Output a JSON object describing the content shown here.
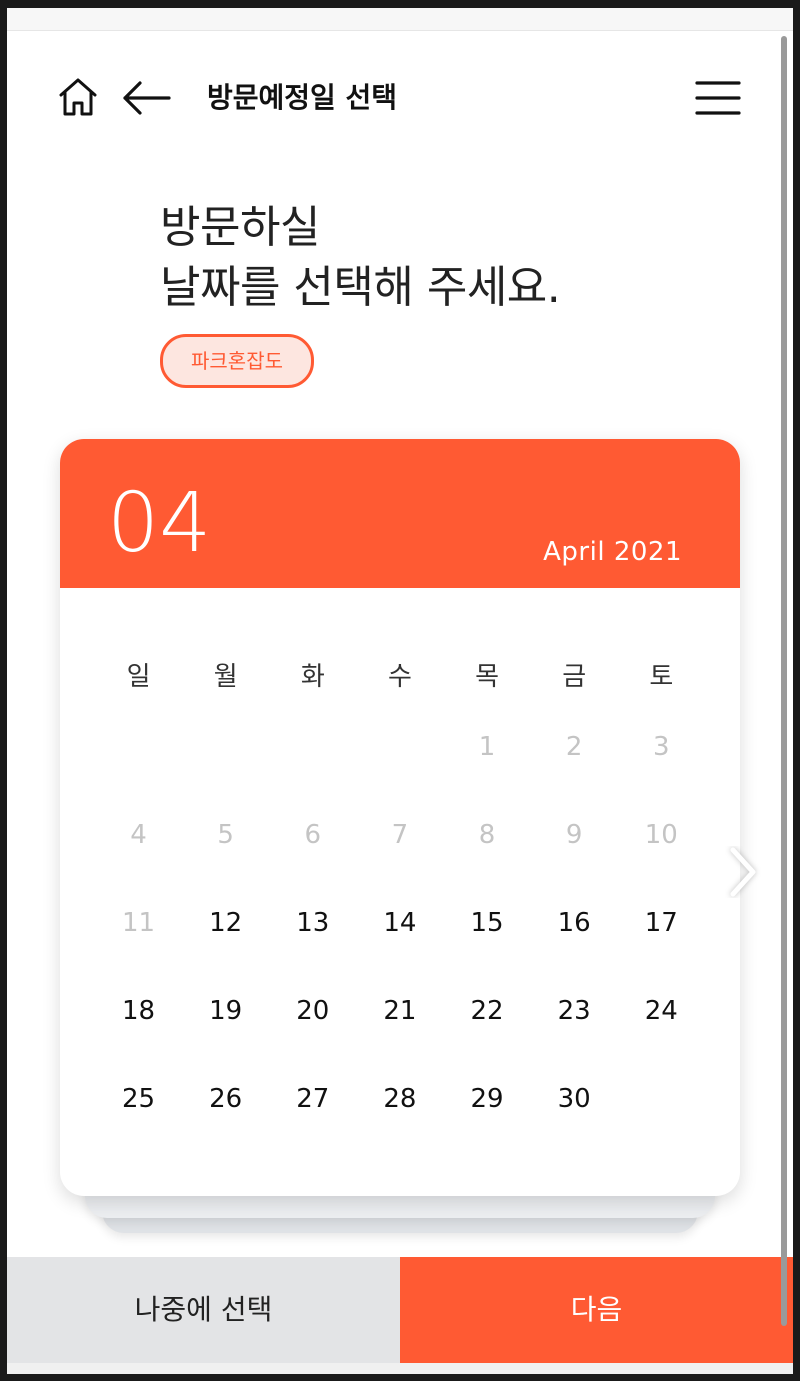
{
  "header": {
    "title": "방문예정일 선택"
  },
  "headline": {
    "line1": "방문하실",
    "line2": "날짜를 선택해 주세요."
  },
  "badge": {
    "label": "파크혼잡도"
  },
  "calendar": {
    "month": "04",
    "month_year": "April 2021",
    "weekdays": [
      "일",
      "월",
      "화",
      "수",
      "목",
      "금",
      "토"
    ],
    "weeks": [
      [
        {
          "d": ""
        },
        {
          "d": ""
        },
        {
          "d": ""
        },
        {
          "d": ""
        },
        {
          "d": "1",
          "disabled": true
        },
        {
          "d": "2",
          "disabled": true
        },
        {
          "d": "3",
          "disabled": true
        }
      ],
      [
        {
          "d": "4",
          "disabled": true
        },
        {
          "d": "5",
          "disabled": true
        },
        {
          "d": "6",
          "disabled": true
        },
        {
          "d": "7",
          "disabled": true
        },
        {
          "d": "8",
          "disabled": true
        },
        {
          "d": "9",
          "disabled": true
        },
        {
          "d": "10",
          "disabled": true
        }
      ],
      [
        {
          "d": "11",
          "disabled": true
        },
        {
          "d": "12"
        },
        {
          "d": "13"
        },
        {
          "d": "14"
        },
        {
          "d": "15"
        },
        {
          "d": "16"
        },
        {
          "d": "17"
        }
      ],
      [
        {
          "d": "18"
        },
        {
          "d": "19"
        },
        {
          "d": "20"
        },
        {
          "d": "21"
        },
        {
          "d": "22"
        },
        {
          "d": "23"
        },
        {
          "d": "24"
        }
      ],
      [
        {
          "d": "25"
        },
        {
          "d": "26"
        },
        {
          "d": "27"
        },
        {
          "d": "28"
        },
        {
          "d": "29"
        },
        {
          "d": "30"
        },
        {
          "d": ""
        }
      ]
    ]
  },
  "footer": {
    "later_label": "나중에 선택",
    "next_label": "다음"
  },
  "colors": {
    "accent": "#ff5a33",
    "badge_bg": "#fde6e0",
    "secondary_button": "#e3e4e6",
    "disabled_text": "#c4c4c4"
  },
  "icons": {
    "home": "home-icon",
    "back": "arrow-left-icon",
    "menu": "hamburger-menu-icon",
    "next_month": "chevron-right-icon"
  }
}
